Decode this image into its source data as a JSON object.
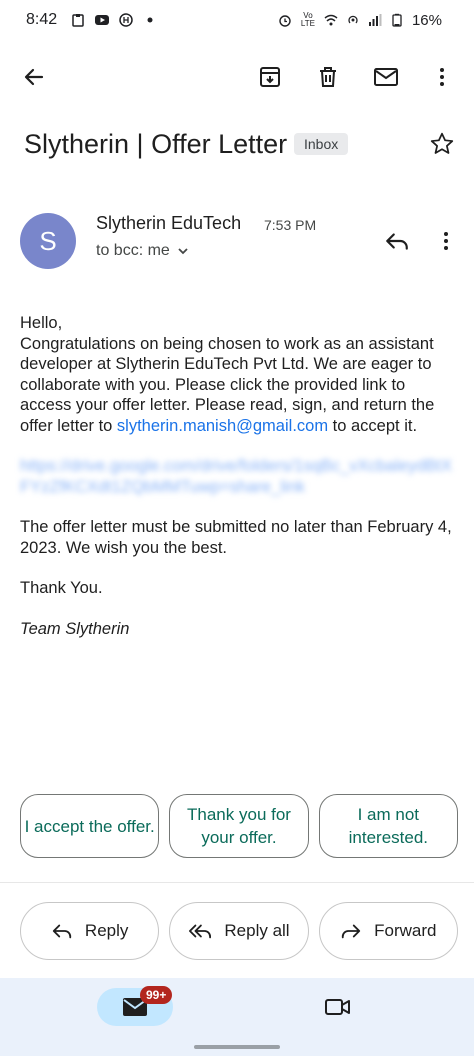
{
  "status_bar": {
    "time": "8:42",
    "battery": "16%",
    "network_label": "Vo LTE"
  },
  "toolbar": {
    "back": "back",
    "archive": "archive",
    "delete": "delete",
    "mark_unread": "mark unread",
    "more": "more"
  },
  "email": {
    "subject": "Slytherin | Offer Letter",
    "label": "Inbox",
    "sender_initial": "S",
    "sender_name": "Slytherin EduTech",
    "time": "7:53 PM",
    "recipient": "to bcc: me",
    "body": {
      "greeting": "Hello,",
      "para1_part1": "Congratulations on being chosen to work as an assistant developer at Slytherin EduTech Pvt Ltd. We are eager to collaborate with you. Please click the provided link to access your offer letter. Please read, sign, and return the offer letter to ",
      "email_link": "slytherin.manish@gmail.com",
      "para1_part2": " to accept it.",
      "hidden_link": "https://drive.google.com/drive/folders/1sqBc_vXcbaleydBtXFYzZfKCXdt1ZQbMMTuwp=share_link",
      "para2": "The offer letter must be submitted no later than February 4, 2023. We wish you the best.",
      "thanks": "Thank You.",
      "signature": "Team Slytherin"
    }
  },
  "smart_replies": [
    "I accept the offer.",
    "Thank you for your offer.",
    "I am not interested."
  ],
  "actions": {
    "reply": "Reply",
    "reply_all": "Reply all",
    "forward": "Forward"
  },
  "bottom_nav": {
    "mail_badge": "99+"
  },
  "colors": {
    "avatar": "#7986cb",
    "link": "#1a73e8",
    "chip_text": "#0b6b5a",
    "nav_bg": "#eaf1fb",
    "badge": "#b3261e"
  }
}
